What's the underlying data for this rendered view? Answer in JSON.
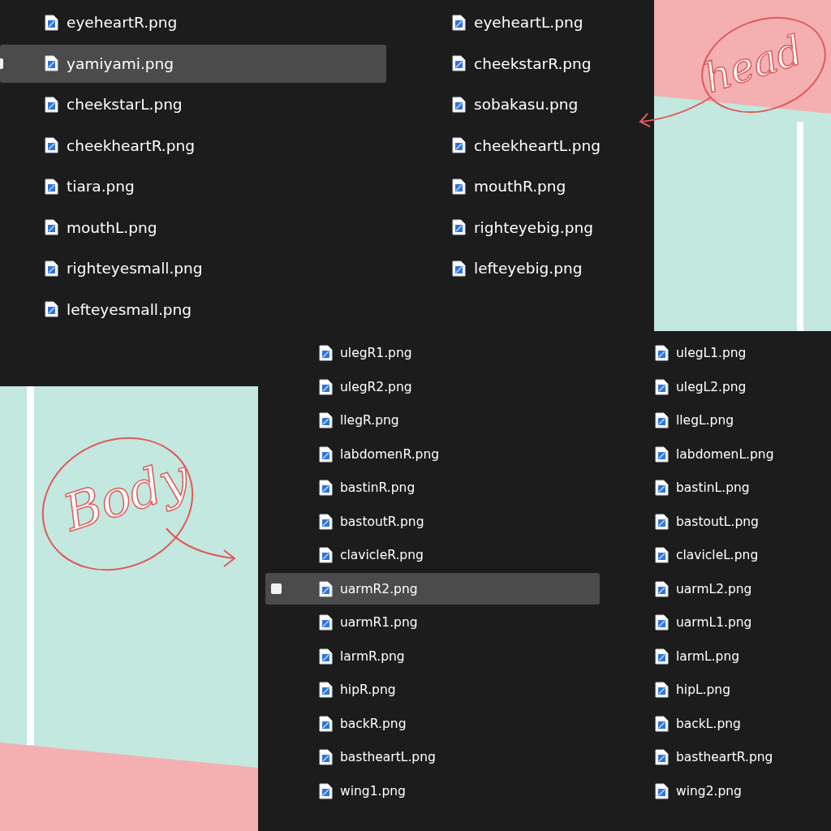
{
  "top_files": {
    "column_1": [
      {
        "name": "eyeheartR.png",
        "selected": false
      },
      {
        "name": "yamiyami.png",
        "selected": true
      },
      {
        "name": "cheekstarL.png",
        "selected": false
      },
      {
        "name": "cheekheartR.png",
        "selected": false
      },
      {
        "name": "tiara.png",
        "selected": false
      },
      {
        "name": "mouthL.png",
        "selected": false
      },
      {
        "name": "righteyesmall.png",
        "selected": false
      },
      {
        "name": "lefteyesmall.png",
        "selected": false
      }
    ],
    "column_2": [
      {
        "name": "eyeheartL.png",
        "selected": false
      },
      {
        "name": "cheekstarR.png",
        "selected": false
      },
      {
        "name": "sobakasu.png",
        "selected": false
      },
      {
        "name": "cheekheartL.png",
        "selected": false
      },
      {
        "name": "mouthR.png",
        "selected": false
      },
      {
        "name": "righteyebig.png",
        "selected": false
      },
      {
        "name": "lefteyebig.png",
        "selected": false
      }
    ]
  },
  "head_panel": {
    "annotation": "head"
  },
  "body_panel": {
    "annotation": "Body"
  },
  "bottom_files": {
    "column_1": [
      {
        "name": "ulegR1.png",
        "selected": false
      },
      {
        "name": "ulegR2.png",
        "selected": false
      },
      {
        "name": "llegR.png",
        "selected": false
      },
      {
        "name": "labdomenR.png",
        "selected": false
      },
      {
        "name": "bastinR.png",
        "selected": false
      },
      {
        "name": "bastoutR.png",
        "selected": false
      },
      {
        "name": "clavicleR.png",
        "selected": false
      },
      {
        "name": "uarmR2.png",
        "selected": true
      },
      {
        "name": "uarmR1.png",
        "selected": false
      },
      {
        "name": "larmR.png",
        "selected": false
      },
      {
        "name": "hipR.png",
        "selected": false
      },
      {
        "name": "backR.png",
        "selected": false
      },
      {
        "name": "bastheartL.png",
        "selected": false
      },
      {
        "name": "wing1.png",
        "selected": false
      }
    ],
    "column_2": [
      {
        "name": "ulegL1.png",
        "selected": false
      },
      {
        "name": "ulegL2.png",
        "selected": false
      },
      {
        "name": "llegL.png",
        "selected": false
      },
      {
        "name": "labdomenL.png",
        "selected": false
      },
      {
        "name": "bastinL.png",
        "selected": false
      },
      {
        "name": "bastoutL.png",
        "selected": false
      },
      {
        "name": "clavicleL.png",
        "selected": false
      },
      {
        "name": "uarmL2.png",
        "selected": false
      },
      {
        "name": "uarmL1.png",
        "selected": false
      },
      {
        "name": "larmL.png",
        "selected": false
      },
      {
        "name": "hipL.png",
        "selected": false
      },
      {
        "name": "backL.png",
        "selected": false
      },
      {
        "name": "bastheartR.png",
        "selected": false
      },
      {
        "name": "wing2.png",
        "selected": false
      }
    ]
  }
}
